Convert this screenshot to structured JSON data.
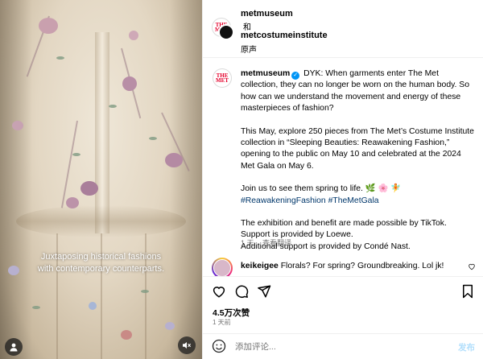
{
  "media": {
    "caption_line1": "Juxtaposing historical fashions",
    "caption_line2": "with contemporary counterparts."
  },
  "header": {
    "user1": "metmuseum",
    "connector": "和",
    "user2": "metcostumeinstitute",
    "audio": "原声"
  },
  "post": {
    "username": "metmuseum",
    "paragraphs": {
      "p1": "DYK: When garments enter The Met collection, they can no longer be worn on the human body. So how can we understand the movement and energy of these masterpieces of fashion?",
      "p2": "This May, explore 250 pieces from The Met’s Costume Institute collection in “Sleeping Beauties: Reawakening Fashion,” opening to the public on May 10 and celebrated at the 2024 Met Gala on May 6.",
      "p3": "Join us to see them spring to life. 🌿 🌸 🧚",
      "hashtags": "#ReawakeningFashion #TheMetGala",
      "p4a": "The exhibition and benefit are made possible by TikTok.",
      "p4b": "Support is provided by Loewe.",
      "p4c": "Additional support is provided by Condé Nast."
    },
    "time_ago": "1 天",
    "see_translation": "查看翻译"
  },
  "comment": {
    "username": "keikeigee",
    "text": "Florals? For spring? Groundbreaking. Lol jk!"
  },
  "stats": {
    "likes": "4.5万次赞",
    "date": "1 天前"
  },
  "add_comment": {
    "placeholder": "添加评论...",
    "post_label": "发布"
  },
  "colors": {
    "link": "#00376b",
    "verified": "#0095f6",
    "post_button": "#b2dffc",
    "met_red": "#e4002b"
  }
}
